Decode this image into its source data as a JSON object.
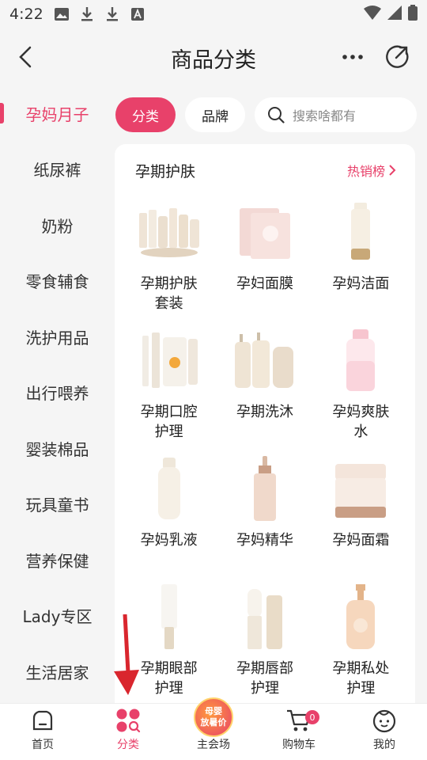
{
  "status_bar": {
    "time": "4:22"
  },
  "header": {
    "title": "商品分类"
  },
  "sidebar": {
    "items": [
      {
        "label": "孕妈月子",
        "active": true
      },
      {
        "label": "纸尿裤"
      },
      {
        "label": "奶粉"
      },
      {
        "label": "零食辅食"
      },
      {
        "label": "洗护用品"
      },
      {
        "label": "出行喂养"
      },
      {
        "label": "婴装棉品"
      },
      {
        "label": "玩具童书"
      },
      {
        "label": "营养保健"
      },
      {
        "label": "Lady专区"
      },
      {
        "label": "生活居家"
      }
    ]
  },
  "tabs": {
    "category": "分类",
    "brand": "品牌"
  },
  "search": {
    "placeholder": "搜索啥都有"
  },
  "panel": {
    "title": "孕期护肤",
    "hot_link": "热销榜",
    "products": [
      {
        "name": "孕期护肤\n套装"
      },
      {
        "name": "孕妇面膜"
      },
      {
        "name": "孕妈洁面"
      },
      {
        "name": "孕期口腔\n护理"
      },
      {
        "name": "孕期洗沐"
      },
      {
        "name": "孕妈爽肤\n水"
      },
      {
        "name": "孕妈乳液"
      },
      {
        "name": "孕妈精华"
      },
      {
        "name": "孕妈面霜"
      },
      {
        "name": "孕期眼部\n护理"
      },
      {
        "name": "孕期唇部\n护理"
      },
      {
        "name": "孕期私处\n护理"
      }
    ]
  },
  "bottom_nav": {
    "home": "首页",
    "category": "分类",
    "main_venue": "主会场",
    "cart": "购物车",
    "cart_count": "0",
    "mine": "我的",
    "promo_line1": "母婴",
    "promo_line2": "放暑价"
  },
  "colors": {
    "accent": "#e8416a",
    "background": "#f5f5f5"
  }
}
